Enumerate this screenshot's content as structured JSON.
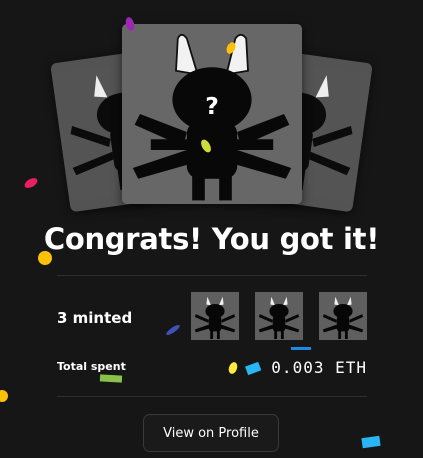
{
  "title": "Congrats! You got it!",
  "minted": {
    "label": "3 minted",
    "count": 3
  },
  "total_spent": {
    "label": "Total spent",
    "value": "0.003 ETH"
  },
  "profile_button": {
    "label": "View on Profile"
  },
  "nft_art": {
    "mystery_glyph": "?"
  },
  "colors": {
    "background": "#161616",
    "card": "#6a6a6a",
    "divider": "#2e2e2e",
    "confetti": [
      "#e91e63",
      "#ffc107",
      "#9c27b0",
      "#29b6f6",
      "#8bc34a",
      "#3f51b5",
      "#cddc39"
    ]
  }
}
